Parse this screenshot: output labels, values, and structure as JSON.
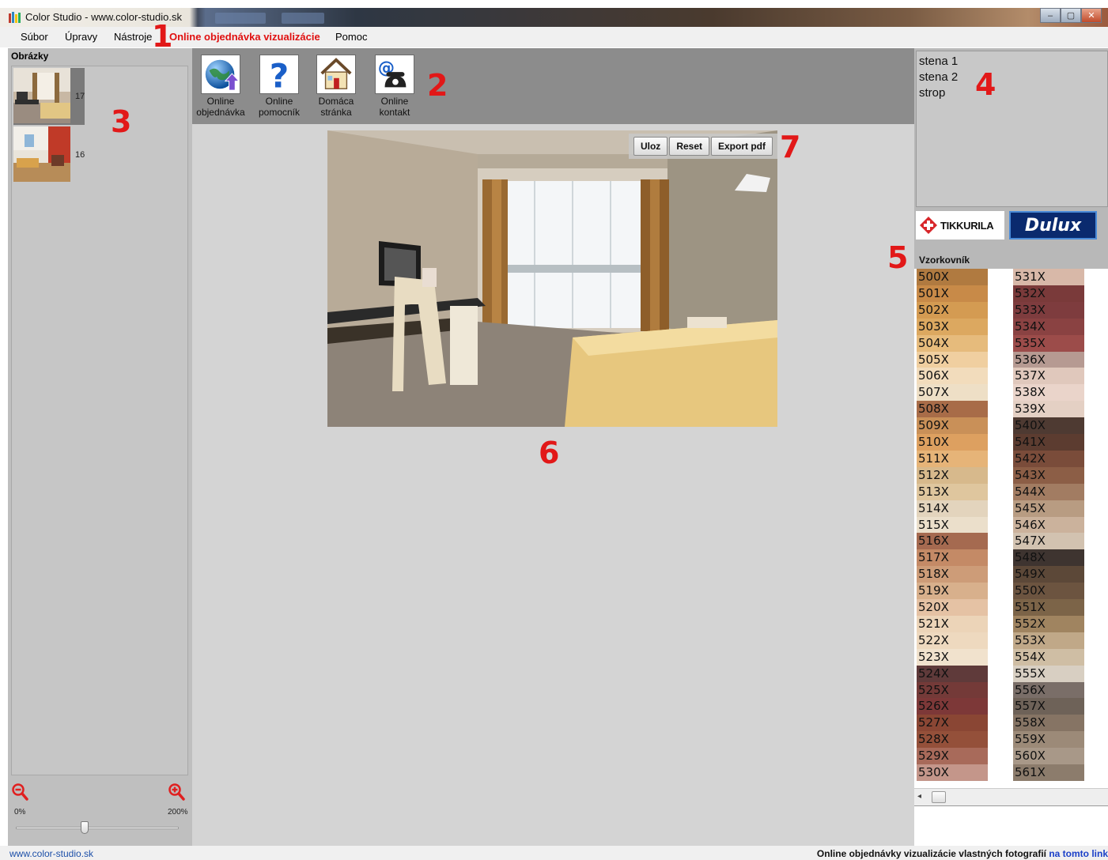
{
  "window": {
    "title": "Color Studio - www.color-studio.sk",
    "buttons": [
      "–",
      "▢",
      "✕"
    ]
  },
  "menu": {
    "items": [
      "Súbor",
      "Úpravy",
      "Nástroje",
      "Online objednávka vizualizácie",
      "Pomoc"
    ]
  },
  "annotations": [
    "1",
    "2",
    "3",
    "4",
    "5",
    "6",
    "7"
  ],
  "left_panel": {
    "title": "Obrázky",
    "thumbnails": [
      {
        "number": "17"
      },
      {
        "number": "16"
      }
    ],
    "zoom": {
      "min_label": "0%",
      "max_label": "200%",
      "value_percent": 42
    }
  },
  "toolbar": {
    "buttons": [
      {
        "label": "Online\nobjednávka",
        "icon": "globe-upload-icon"
      },
      {
        "label": "Online\npomocník",
        "icon": "help-question-icon"
      },
      {
        "label": "Domáca\nstránka",
        "icon": "home-icon"
      },
      {
        "label": "Online\nkontakt",
        "icon": "email-phone-icon"
      }
    ]
  },
  "image_buttons": {
    "save": "Uloz",
    "reset": "Reset",
    "export": "Export pdf"
  },
  "surfaces": [
    "stena 1",
    "stena 2",
    "strop"
  ],
  "brands": {
    "tikkurila": "TIKKURILA",
    "dulux": "Dulux"
  },
  "swatches": {
    "title": "Vzorkovník",
    "left": [
      {
        "code": "500X",
        "color": "#b07a40"
      },
      {
        "code": "501X",
        "color": "#c88a48"
      },
      {
        "code": "502X",
        "color": "#d49b52"
      },
      {
        "code": "503X",
        "color": "#dca860"
      },
      {
        "code": "504X",
        "color": "#e6bb7c"
      },
      {
        "code": "505X",
        "color": "#f0cfa0"
      },
      {
        "code": "506X",
        "color": "#f2dcbc"
      },
      {
        "code": "507X",
        "color": "#eedfc6"
      },
      {
        "code": "508X",
        "color": "#a86c48"
      },
      {
        "code": "509X",
        "color": "#c99058"
      },
      {
        "code": "510X",
        "color": "#dda060"
      },
      {
        "code": "511X",
        "color": "#e6b478"
      },
      {
        "code": "512X",
        "color": "#d7b98c"
      },
      {
        "code": "513X",
        "color": "#dfc69e"
      },
      {
        "code": "514X",
        "color": "#e3d4bd"
      },
      {
        "code": "515X",
        "color": "#ebdfcb"
      },
      {
        "code": "516X",
        "color": "#a56a50"
      },
      {
        "code": "517X",
        "color": "#c48a66"
      },
      {
        "code": "518X",
        "color": "#cd9c78"
      },
      {
        "code": "519X",
        "color": "#d8b08c"
      },
      {
        "code": "520X",
        "color": "#e5c2a4"
      },
      {
        "code": "521X",
        "color": "#ecd4b8"
      },
      {
        "code": "522X",
        "color": "#eed9bf"
      },
      {
        "code": "523X",
        "color": "#f1e2cd"
      },
      {
        "code": "524X",
        "color": "#5f3a3a"
      },
      {
        "code": "525X",
        "color": "#743a38"
      },
      {
        "code": "526X",
        "color": "#7d3838"
      },
      {
        "code": "527X",
        "color": "#8a4634"
      },
      {
        "code": "528X",
        "color": "#94503a"
      },
      {
        "code": "529X",
        "color": "#a86a5a"
      },
      {
        "code": "530X",
        "color": "#c4968a"
      }
    ],
    "right": [
      {
        "code": "531X",
        "color": "#d8b8a8"
      },
      {
        "code": "532X",
        "color": "#7a3a3a"
      },
      {
        "code": "533X",
        "color": "#7e3c3e"
      },
      {
        "code": "534X",
        "color": "#8a4242"
      },
      {
        "code": "535X",
        "color": "#9c4c4a"
      },
      {
        "code": "536X",
        "color": "#b69a92"
      },
      {
        "code": "537X",
        "color": "#e0c8bc"
      },
      {
        "code": "538X",
        "color": "#ead4ca"
      },
      {
        "code": "539X",
        "color": "#e4d0c4"
      },
      {
        "code": "540X",
        "color": "#4e3a32"
      },
      {
        "code": "541X",
        "color": "#5c3c30"
      },
      {
        "code": "542X",
        "color": "#7a4c3a"
      },
      {
        "code": "543X",
        "color": "#8c5e46"
      },
      {
        "code": "544X",
        "color": "#a27c62"
      },
      {
        "code": "545X",
        "color": "#b89c82"
      },
      {
        "code": "546X",
        "color": "#cbb29c"
      },
      {
        "code": "547X",
        "color": "#d2c2b0"
      },
      {
        "code": "548X",
        "color": "#3e3430"
      },
      {
        "code": "549X",
        "color": "#5c4838"
      },
      {
        "code": "550X",
        "color": "#6c5440"
      },
      {
        "code": "551X",
        "color": "#7c6448"
      },
      {
        "code": "552X",
        "color": "#a08460"
      },
      {
        "code": "553X",
        "color": "#c0a888"
      },
      {
        "code": "554X",
        "color": "#cfbea4"
      },
      {
        "code": "555X",
        "color": "#d8cfc2"
      },
      {
        "code": "556X",
        "color": "#7a6e68"
      },
      {
        "code": "557X",
        "color": "#6e6258"
      },
      {
        "code": "558X",
        "color": "#867464"
      },
      {
        "code": "559X",
        "color": "#9c8a78"
      },
      {
        "code": "560X",
        "color": "#a89888"
      },
      {
        "code": "561X",
        "color": "#8c7c6c"
      }
    ]
  },
  "status": {
    "left": "www.color-studio.sk",
    "right_text": "Online objednávky vizualizácie vlastných fotografií ",
    "right_link": "na tomto link"
  }
}
